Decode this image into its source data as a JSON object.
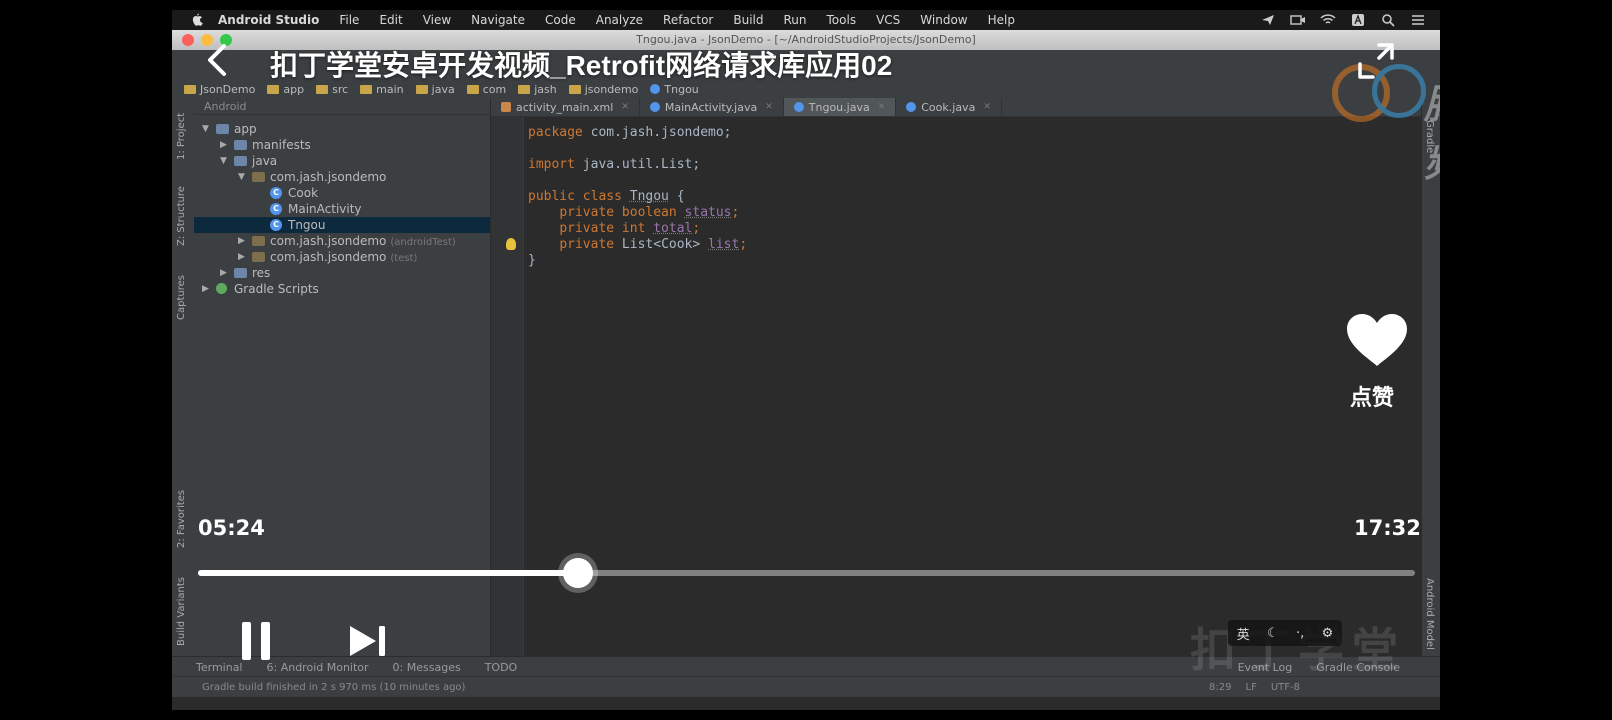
{
  "video": {
    "title": "扣丁学堂安卓开发视频_Retrofit网络请求库应用02",
    "current_time": "05:24",
    "total_time": "17:32",
    "progress": 0.312,
    "like_label": "点赞",
    "watermark_text": "腾讯视频",
    "watermark2_text": "扣丁学堂"
  },
  "mac_menu": {
    "items": [
      "Android Studio",
      "File",
      "Edit",
      "View",
      "Navigate",
      "Code",
      "Analyze",
      "Refactor",
      "Build",
      "Run",
      "Tools",
      "VCS",
      "Window",
      "Help"
    ]
  },
  "ide": {
    "window_title": "Tngou.java - JsonDemo - [~/AndroidStudioProjects/JsonDemo]",
    "breadcrumbs": [
      "JsonDemo",
      "app",
      "src",
      "main",
      "java",
      "com",
      "jash",
      "jsondemo",
      "Tngou"
    ],
    "project_view": "Android",
    "tree": [
      {
        "label": "app",
        "level": 0,
        "arrow": "▼",
        "icon": "folder"
      },
      {
        "label": "manifests",
        "level": 1,
        "arrow": "▶",
        "icon": "folder"
      },
      {
        "label": "java",
        "level": 1,
        "arrow": "▼",
        "icon": "folder"
      },
      {
        "label": "com.jash.jsondemo",
        "level": 2,
        "arrow": "▼",
        "icon": "package"
      },
      {
        "label": "Cook",
        "level": 3,
        "arrow": "",
        "icon": "class"
      },
      {
        "label": "MainActivity",
        "level": 3,
        "arrow": "",
        "icon": "class"
      },
      {
        "label": "Tngou",
        "level": 3,
        "arrow": "",
        "icon": "class",
        "selected": true
      },
      {
        "label": "com.jash.jsondemo",
        "suffix": "(androidTest)",
        "level": 2,
        "arrow": "▶",
        "icon": "package"
      },
      {
        "label": "com.jash.jsondemo",
        "suffix": "(test)",
        "level": 2,
        "arrow": "▶",
        "icon": "package"
      },
      {
        "label": "res",
        "level": 1,
        "arrow": "▶",
        "icon": "folder"
      },
      {
        "label": "Gradle Scripts",
        "level": 0,
        "arrow": "▶",
        "icon": "gradle"
      }
    ],
    "tabs": [
      {
        "label": "activity_main.xml",
        "active": false
      },
      {
        "label": "MainActivity.java",
        "active": false
      },
      {
        "label": "Tngou.java",
        "active": true
      },
      {
        "label": "Cook.java",
        "active": false
      }
    ],
    "code": {
      "l1_kw": "package",
      "l1_rest": " com.jash.jsondemo;",
      "l2_kw": "import",
      "l2_rest": " java.util.List;",
      "l3_kw": "public class",
      "l3_cls": "Tngou",
      "l3_rest": " {",
      "l4_kw": "private boolean",
      "l4_fld": "status",
      "l4_end": ";",
      "l5_kw": "private int",
      "l5_fld": "total",
      "l5_end": ";",
      "l6_kw": "private",
      "l6_type": " List<Cook> ",
      "l6_fld": "list",
      "l6_end": ";",
      "l7": "}"
    },
    "left_stripe": [
      "1: Project",
      "Z: Structure",
      "Captures",
      "2: Favorites",
      "Build Variants"
    ],
    "right_stripe": [
      "Gradle",
      "Android Model"
    ],
    "bottom_tools": [
      "Terminal",
      "6: Android Monitor",
      "0: Messages",
      "TODO"
    ],
    "bottom_tools_right": [
      "Event Log",
      "Gradle Console"
    ],
    "status_message": "Gradle build finished in 2 s 970 ms (10 minutes ago)",
    "status_pos": [
      "8:29",
      "LF",
      "UTF-8"
    ]
  },
  "ime": {
    "lang": "英"
  }
}
